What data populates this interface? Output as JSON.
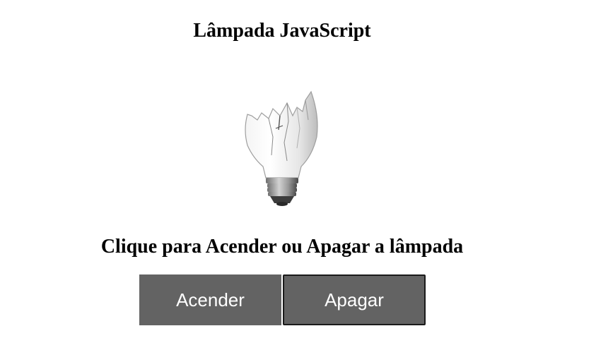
{
  "page": {
    "title": "Lâmpada JavaScript",
    "instruction": "Clique para Acender ou Apagar a lâmpada"
  },
  "bulb": {
    "icon": "broken-lightbulb-icon",
    "state": "broken"
  },
  "buttons": {
    "on_label": "Acender",
    "off_label": "Apagar"
  },
  "colors": {
    "button_bg": "#636363",
    "button_text": "#ffffff"
  }
}
